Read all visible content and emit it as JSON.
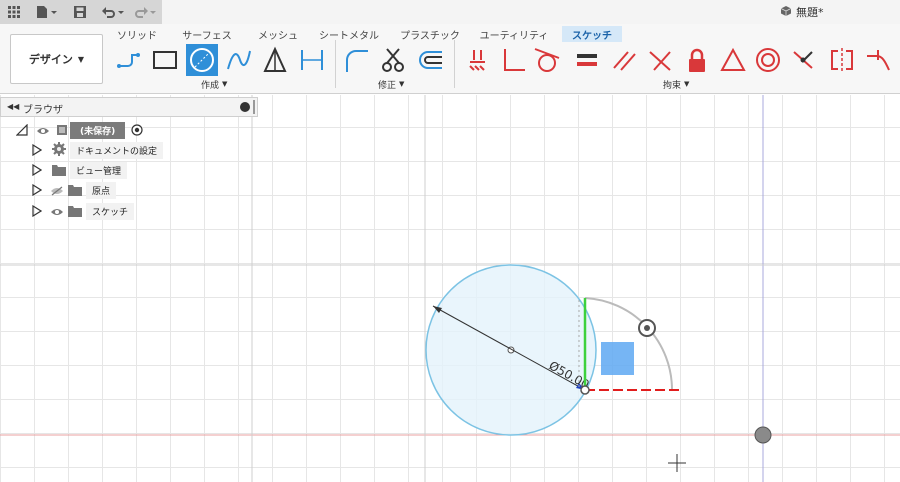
{
  "app_bar": {
    "document_title": "無題*",
    "icons": [
      "grid-icon",
      "file-icon",
      "save-icon",
      "undo-icon",
      "redo-icon",
      "cube-icon"
    ]
  },
  "ribbon": {
    "tabs": [
      "ソリッド",
      "サーフェス",
      "メッシュ",
      "シートメタル",
      "プラスチック",
      "ユーティリティ",
      "スケッチ"
    ],
    "active_tab": "スケッチ",
    "workspace": "デザイン",
    "groups": {
      "create": "作成",
      "modify": "修正",
      "constraints": "拘束"
    }
  },
  "browser": {
    "title": "ブラウザ",
    "root": "(未保存)",
    "items": [
      "ドキュメントの設定",
      "ビュー管理",
      "原点",
      "スケッチ"
    ]
  },
  "sketch": {
    "dimension": "Ø50.00"
  },
  "colors": {
    "accent_blue": "#2f8fd8",
    "constraint_red": "#d9383a",
    "circle_fill": "#e4f3fb",
    "circle_stroke": "#7cc3e4"
  }
}
